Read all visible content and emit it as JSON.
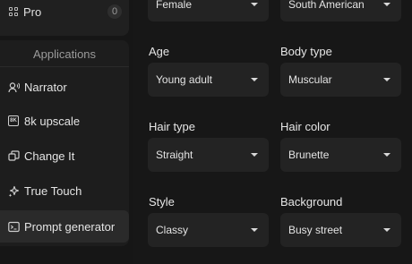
{
  "sidebar": {
    "pro": {
      "label": "Pro",
      "badge": "0"
    },
    "section_title": "Applications",
    "items": [
      {
        "label": "Narrator",
        "icon": "narrator-icon"
      },
      {
        "label": "8k upscale",
        "icon": "8k-icon",
        "icon_text": "8K"
      },
      {
        "label": "Change It",
        "icon": "change-icon"
      },
      {
        "label": "True Touch",
        "icon": "sparkle-icon"
      },
      {
        "label": "Prompt generator",
        "icon": "terminal-icon",
        "active": true
      }
    ]
  },
  "form": {
    "gender": {
      "value": "Female"
    },
    "ethnicity": {
      "value": "South American"
    },
    "age": {
      "label": "Age",
      "value": "Young adult"
    },
    "body_type": {
      "label": "Body type",
      "value": "Muscular"
    },
    "hair_type": {
      "label": "Hair type",
      "value": "Straight"
    },
    "hair_color": {
      "label": "Hair color",
      "value": "Brunette"
    },
    "style": {
      "label": "Style",
      "value": "Classy"
    },
    "background": {
      "label": "Background",
      "value": "Busy street"
    }
  }
}
